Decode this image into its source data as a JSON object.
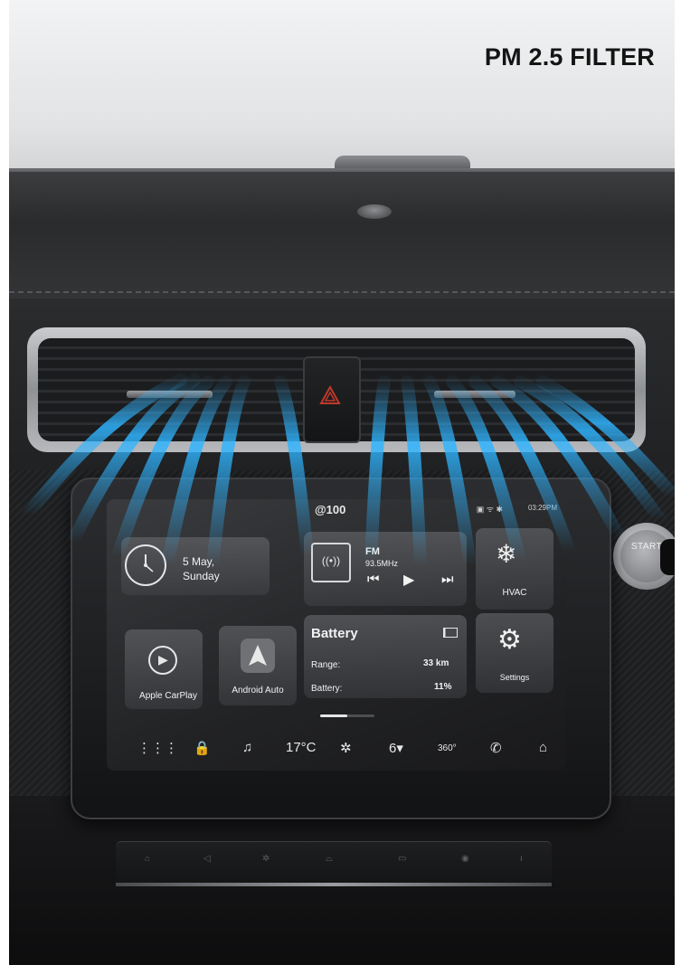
{
  "headline": "PM 2.5 FILTER",
  "vehicle": {
    "start_button_label": "START"
  },
  "screen": {
    "brand_logo": "@100",
    "status_time": "03:29PM",
    "status_icons_text": "▣ ᯤ ✱",
    "clock_tile": {
      "date_line1": "5 May,",
      "date_line2": "Sunday"
    },
    "radio_tile": {
      "band": "FM",
      "frequency": "93.5MHz",
      "icon": "radio-broadcast-icon",
      "controls": [
        "previous-track-icon",
        "play-icon",
        "next-track-icon"
      ]
    },
    "hvac_tile": {
      "label": "HVAC",
      "icon": "snowflake-fan-icon"
    },
    "carplay_tile": {
      "label": "Apple CarPlay",
      "icon": "carplay-icon"
    },
    "android_tile": {
      "label": "Android Auto",
      "icon": "android-auto-icon"
    },
    "battery_tile": {
      "title": "Battery",
      "range_label": "Range:",
      "range_value": "33 km",
      "battery_label": "Battery:",
      "battery_value": "11%",
      "battery_level_fraction": 0.11
    },
    "settings_tile": {
      "label": "Settings",
      "icon": "gear-icon"
    },
    "dock": {
      "temperature": "17°C",
      "fan_speed": "6",
      "camera_label": "360°",
      "items": [
        "apps-grid-icon",
        "lock-icon",
        "music-note-icon",
        "temperature",
        "fan-icon",
        "fan-speed",
        "360-camera-icon",
        "phone-icon",
        "home-icon"
      ]
    }
  },
  "colors": {
    "airflow_blue": "#2fb4ff",
    "screen_text": "#f2f2f2",
    "hazard_red": "#c0392b"
  }
}
